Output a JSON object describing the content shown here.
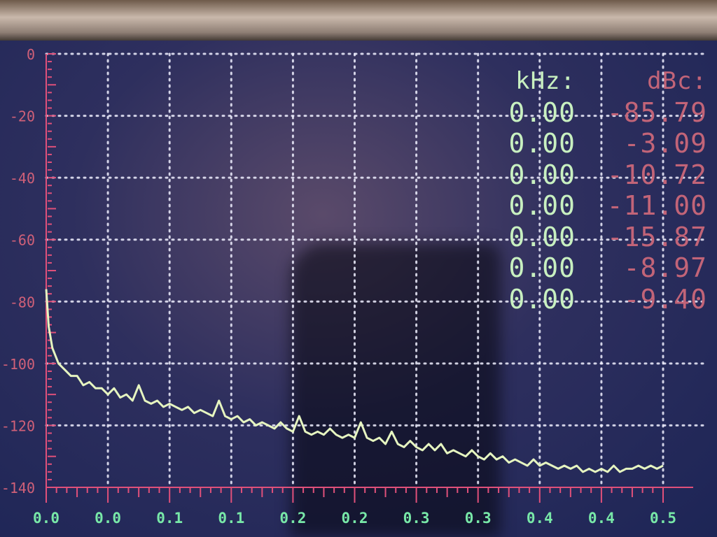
{
  "chart_data": {
    "type": "line",
    "xlabel": "",
    "ylabel": "",
    "xlim": [
      0.0,
      0.5
    ],
    "ylim": [
      -140,
      0
    ],
    "x_tick_labels": [
      "0.0",
      "0.0",
      "0.1",
      "0.1",
      "0.2",
      "0.2",
      "0.3",
      "0.3",
      "0.4",
      "0.4",
      "0.5"
    ],
    "y_tick_labels": [
      "0",
      "-20",
      "-40",
      "-60",
      "-80",
      "-100",
      "-120",
      "-140"
    ],
    "y_ticks": [
      0,
      -20,
      -40,
      -60,
      -80,
      -100,
      -120,
      -140
    ],
    "grid": true,
    "series": [
      {
        "x": [
          0.0,
          0.002,
          0.005,
          0.01,
          0.015,
          0.02,
          0.025,
          0.03,
          0.035,
          0.04,
          0.045,
          0.05,
          0.055,
          0.06,
          0.065,
          0.07,
          0.075,
          0.08,
          0.085,
          0.09,
          0.095,
          0.1,
          0.105,
          0.11,
          0.115,
          0.12,
          0.125,
          0.13,
          0.135,
          0.14,
          0.145,
          0.15,
          0.155,
          0.16,
          0.165,
          0.17,
          0.175,
          0.18,
          0.185,
          0.19,
          0.195,
          0.2,
          0.205,
          0.21,
          0.215,
          0.22,
          0.225,
          0.23,
          0.235,
          0.24,
          0.245,
          0.25,
          0.255,
          0.26,
          0.265,
          0.27,
          0.275,
          0.28,
          0.285,
          0.29,
          0.295,
          0.3,
          0.305,
          0.31,
          0.315,
          0.32,
          0.325,
          0.33,
          0.335,
          0.34,
          0.345,
          0.35,
          0.355,
          0.36,
          0.365,
          0.37,
          0.375,
          0.38,
          0.385,
          0.39,
          0.395,
          0.4,
          0.405,
          0.41,
          0.415,
          0.42,
          0.425,
          0.43,
          0.435,
          0.44,
          0.445,
          0.45,
          0.455,
          0.46,
          0.465,
          0.47,
          0.475,
          0.48,
          0.485,
          0.49,
          0.495,
          0.5
        ],
        "values": [
          -76,
          -88,
          -95,
          -100,
          -102,
          -104,
          -104,
          -107,
          -106,
          -108,
          -108,
          -110,
          -108,
          -111,
          -110,
          -112,
          -107,
          -112,
          -113,
          -112,
          -114,
          -113,
          -114,
          -115,
          -114,
          -116,
          -115,
          -116,
          -117,
          -112,
          -117,
          -118,
          -117,
          -119,
          -118,
          -120,
          -119,
          -120,
          -121,
          -119,
          -121,
          -122,
          -117,
          -122,
          -123,
          -122,
          -123,
          -121,
          -123,
          -124,
          -123,
          -124,
          -119,
          -124,
          -125,
          -124,
          -126,
          -122,
          -126,
          -127,
          -125,
          -127,
          -128,
          -126,
          -128,
          -126,
          -129,
          -128,
          -129,
          -130,
          -128,
          -130,
          -131,
          -129,
          -131,
          -130,
          -132,
          -131,
          -132,
          -133,
          -131,
          -133,
          -132,
          -133,
          -134,
          -133,
          -134,
          -133,
          -135,
          -134,
          -135,
          -134,
          -135,
          -133,
          -135,
          -134,
          -134,
          -133,
          -134,
          -133,
          -134,
          -133
        ]
      }
    ]
  },
  "readout": {
    "khz_header": "kHz:",
    "dbc_header": "dBc:",
    "khz_values": [
      "0.00",
      "0.00",
      "0.00",
      "0.00",
      "0.00",
      "0.00",
      "0.00"
    ],
    "dbc_values": [
      "-85.79",
      "-3.09",
      "-10.72",
      "-11.00",
      "-15.87",
      "-8.97",
      "-9.40"
    ]
  },
  "colors": {
    "trace": "#e6f5c0",
    "grid": "#f0f0ff",
    "axis": "#e0507a",
    "x_tick_text": "#78e8a8",
    "y_tick_text": "#d06078",
    "khz_text": "#c8f0c0",
    "dbc_text": "#c26478"
  }
}
